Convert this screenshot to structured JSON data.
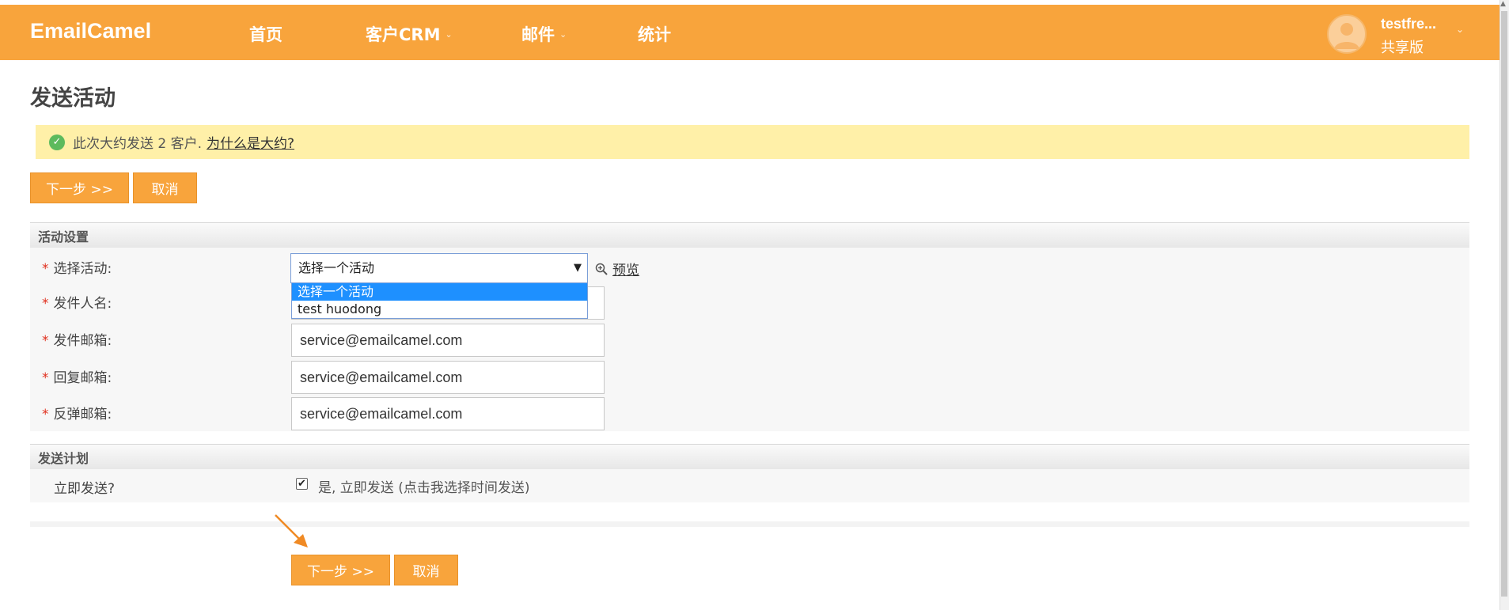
{
  "header": {
    "brand": "EmailCamel",
    "nav": [
      {
        "label": "首页"
      },
      {
        "label": "客户CRM"
      },
      {
        "label": "邮件"
      },
      {
        "label": "统计"
      }
    ],
    "user": {
      "name": "testfre...",
      "plan": "共享版"
    }
  },
  "page": {
    "title": "发送活动"
  },
  "notice": {
    "check_glyph": "✓",
    "text": "此次大约发送 2 客户.",
    "link": "为什么是大约?"
  },
  "top_actions": {
    "next": "下一步 >>",
    "cancel": "取消"
  },
  "campaign_settings": {
    "section_title": "活动设置",
    "required_mark": "*",
    "fields": {
      "campaign": {
        "label": "选择活动:",
        "selected": "选择一个活动",
        "arrow": "▼",
        "options": [
          "选择一个活动",
          "test huodong"
        ],
        "preview_label": "预览"
      },
      "sender_name": {
        "label": "发件人名:",
        "value": ""
      },
      "sender_email": {
        "label": "发件邮箱:",
        "value": "service@emailcamel.com"
      },
      "reply_email": {
        "label": "回复邮箱:",
        "value": "service@emailcamel.com"
      },
      "bounce_email": {
        "label": "反弹邮箱:",
        "value": "service@emailcamel.com"
      }
    }
  },
  "send_plan": {
    "section_title": "发送计划",
    "send_now_label": "立即发送?",
    "send_now_checked": true,
    "check_glyph": "✔",
    "send_now_text": "是, 立即发送 (点击我选择时间发送)"
  },
  "bottom_actions": {
    "next": "下一步 >>",
    "cancel": "取消"
  },
  "colors": {
    "brand_orange": "#f8a43c",
    "notice_yellow": "#fff0a8",
    "select_highlight": "#1e90ff"
  }
}
